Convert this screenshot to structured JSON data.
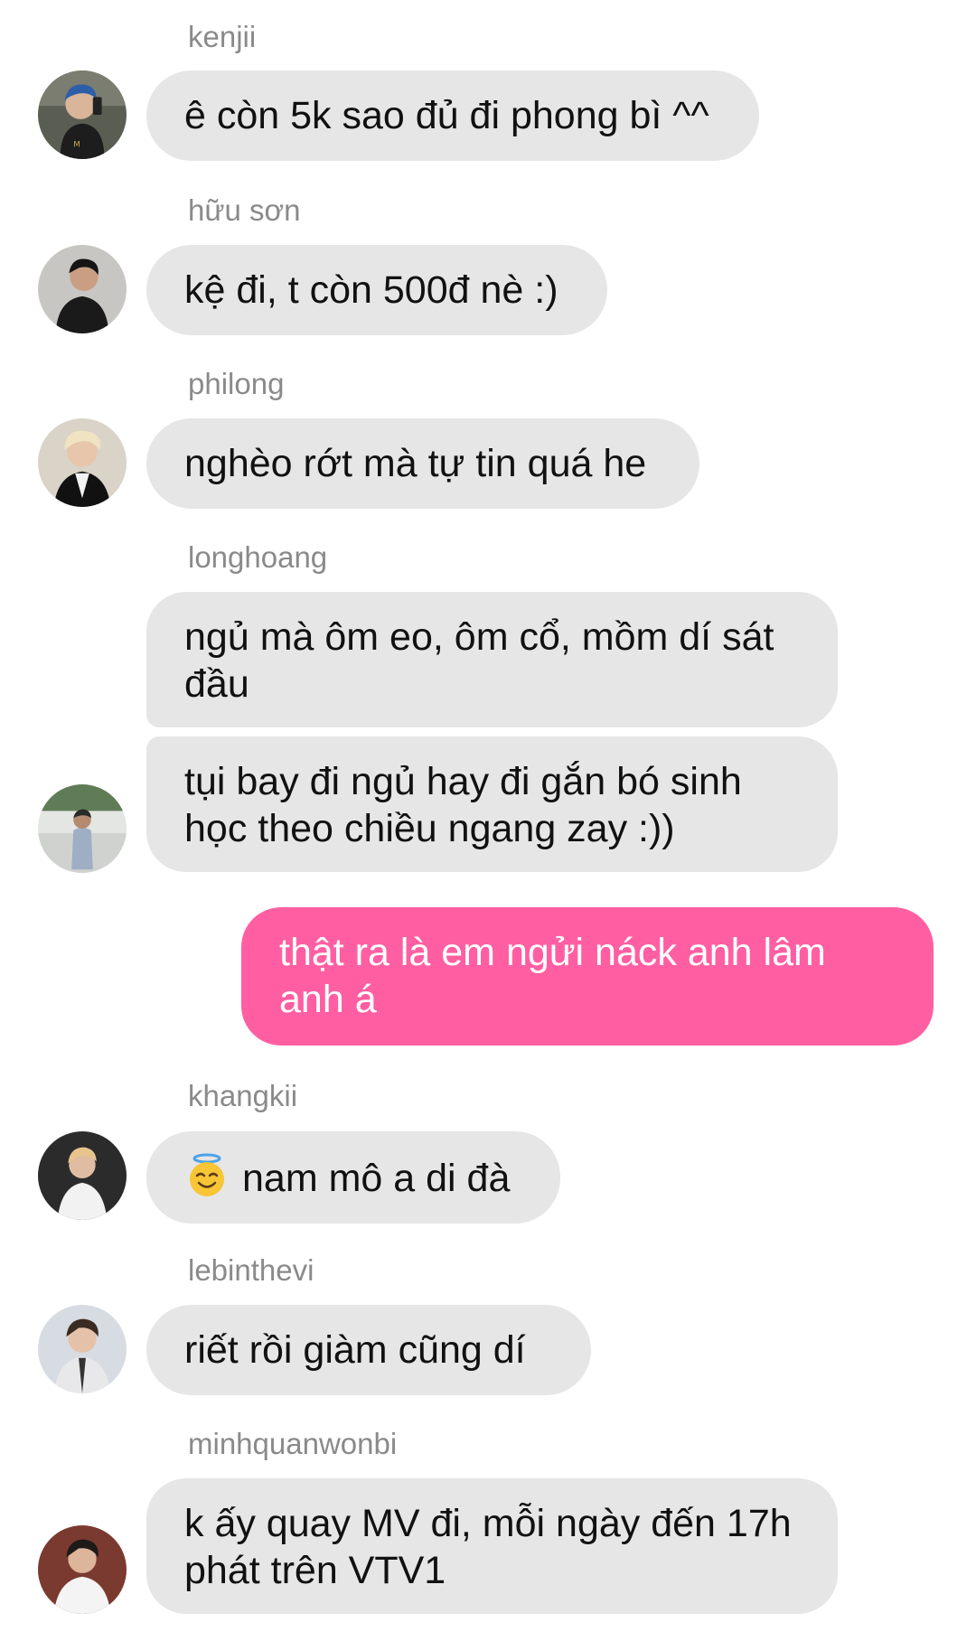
{
  "messages": [
    {
      "sender": "kenjii",
      "text": "ê còn 5k sao đủ đi phong bì ^^"
    },
    {
      "sender": "hữu sơn",
      "text": "kệ đi, t còn 500đ nè :)"
    },
    {
      "sender": "philong",
      "text": "nghèo rớt mà tự tin quá he"
    },
    {
      "sender": "longhoang",
      "text": "ngủ mà ôm eo, ôm cổ, mồm dí sát đầu"
    },
    {
      "sender": "longhoang",
      "text": "tụi bay đi ngủ hay đi gắn bó sinh học theo chiều ngang zay :))"
    },
    {
      "sender": "me",
      "text": "thật ra là em ngửi náck anh lâm anh á"
    },
    {
      "sender": "khangkii",
      "text": "nam mô a di đà",
      "emoji": "smiling-face-with-halo-icon"
    },
    {
      "sender": "lebinthevi",
      "text": "riết rồi giàm cũng dí"
    },
    {
      "sender": "minhquanwonbi",
      "text": "k ấy quay MV đi, mỗi ngày đến 17h phát trên VTV1"
    }
  ],
  "colors": {
    "incoming_bubble": "#e6e6e6",
    "outgoing_bubble": "#ff5fa2",
    "sender_name": "#8a8a8a"
  }
}
